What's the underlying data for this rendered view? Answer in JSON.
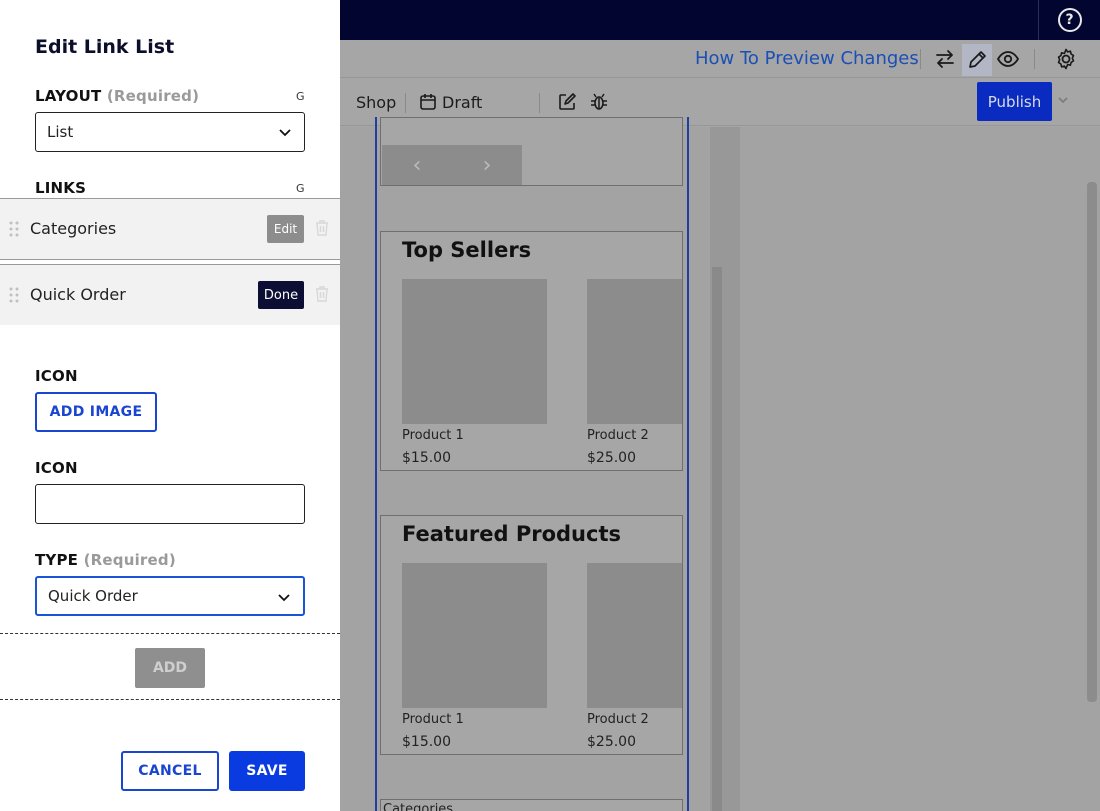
{
  "panel": {
    "title": "Edit Link List",
    "layout": {
      "label": "LAYOUT",
      "required": "(Required)",
      "marker": "G",
      "value": "List"
    },
    "links": {
      "label": "LINKS",
      "marker": "G",
      "items": [
        {
          "name": "Categories",
          "action": "Edit"
        },
        {
          "name": "Quick Order",
          "action": "Done"
        }
      ]
    },
    "icon_image": {
      "label": "ICON",
      "button": "ADD IMAGE"
    },
    "icon_text": {
      "label": "ICON",
      "value": ""
    },
    "type": {
      "label": "TYPE",
      "required": "(Required)",
      "value": "Quick Order"
    },
    "add_button": "ADD",
    "cancel_button": "CANCEL",
    "save_button": "SAVE"
  },
  "header": {
    "preview_link": "How To Preview Changes",
    "help_icon": "?"
  },
  "toolbar": {
    "shop": "Shop",
    "draft": "Draft",
    "publish": "Publish"
  },
  "preview": {
    "top_sellers": {
      "title": "Top Sellers",
      "products": [
        {
          "name": "Product 1",
          "price": "$15.00"
        },
        {
          "name": "Product 2",
          "price": "$25.00"
        }
      ]
    },
    "featured": {
      "title": "Featured Products",
      "products": [
        {
          "name": "Product 1",
          "price": "$15.00"
        },
        {
          "name": "Product 2",
          "price": "$25.00"
        }
      ]
    },
    "categories_partial": "Categories"
  },
  "icons": [
    "help-icon",
    "swap-icon",
    "pencil-icon",
    "eye-icon",
    "gear-icon",
    "calendar-icon",
    "edit-square-icon",
    "bug-icon",
    "chevron-down-icon",
    "grip-icon",
    "trash-icon",
    "chevron-left-icon",
    "chevron-right-icon"
  ]
}
